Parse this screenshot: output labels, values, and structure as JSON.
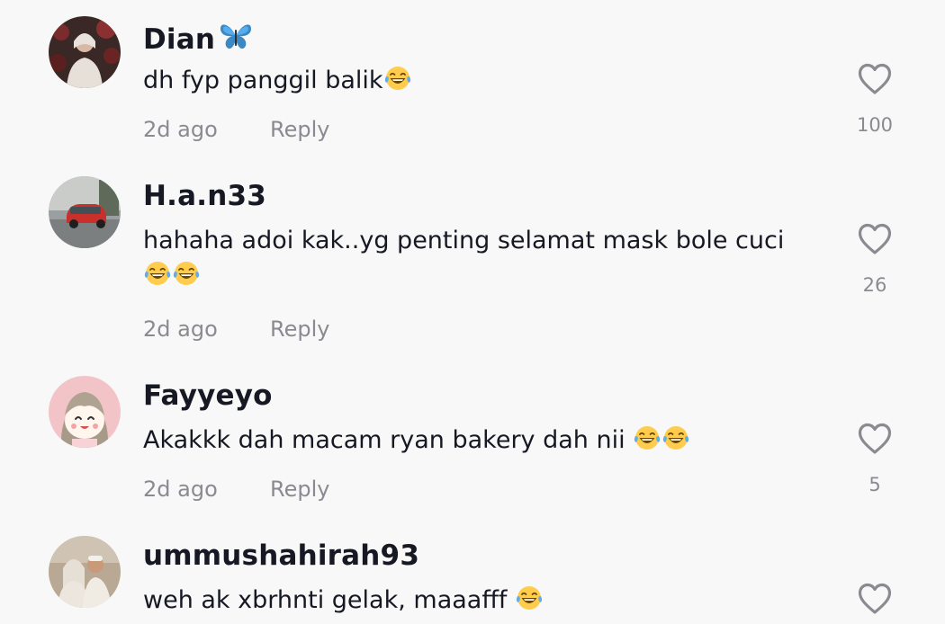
{
  "comments": [
    {
      "username": "Dian",
      "username_suffix_icon": "butterfly-emoji",
      "text": "dh fyp panggil balik",
      "text_emojis": [
        "face-with-tears-of-joy"
      ],
      "time": "2d ago",
      "reply_label": "Reply",
      "likes": "100",
      "avatar": "profile-photo"
    },
    {
      "username": "H.a.n33",
      "text": "hahaha adoi kak..yg penting selamat mask bole cuci",
      "text_emojis": [
        "face-with-tears-of-joy",
        "face-with-tears-of-joy"
      ],
      "time": "2d ago",
      "reply_label": "Reply",
      "likes": "26",
      "avatar": "car-photo"
    },
    {
      "username": "Fayyeyo",
      "text": "Akakkk dah macam ryan bakery dah nii ",
      "text_emojis": [
        "face-with-tears-of-joy",
        "face-with-tears-of-joy"
      ],
      "time": "2d ago",
      "reply_label": "Reply",
      "likes": "5",
      "avatar": "cartoon-girl"
    },
    {
      "username": "ummushahirah93",
      "text": "weh ak xbrhnti gelak, maaafff ",
      "text_emojis": [
        "face-with-tears-of-joy"
      ],
      "avatar": "couple-photo"
    }
  ],
  "colors": {
    "background": "#f8f8f8",
    "username": "#161823",
    "text": "#161823",
    "meta": "#8a8b91",
    "heart_outline": "#8a8b91"
  }
}
